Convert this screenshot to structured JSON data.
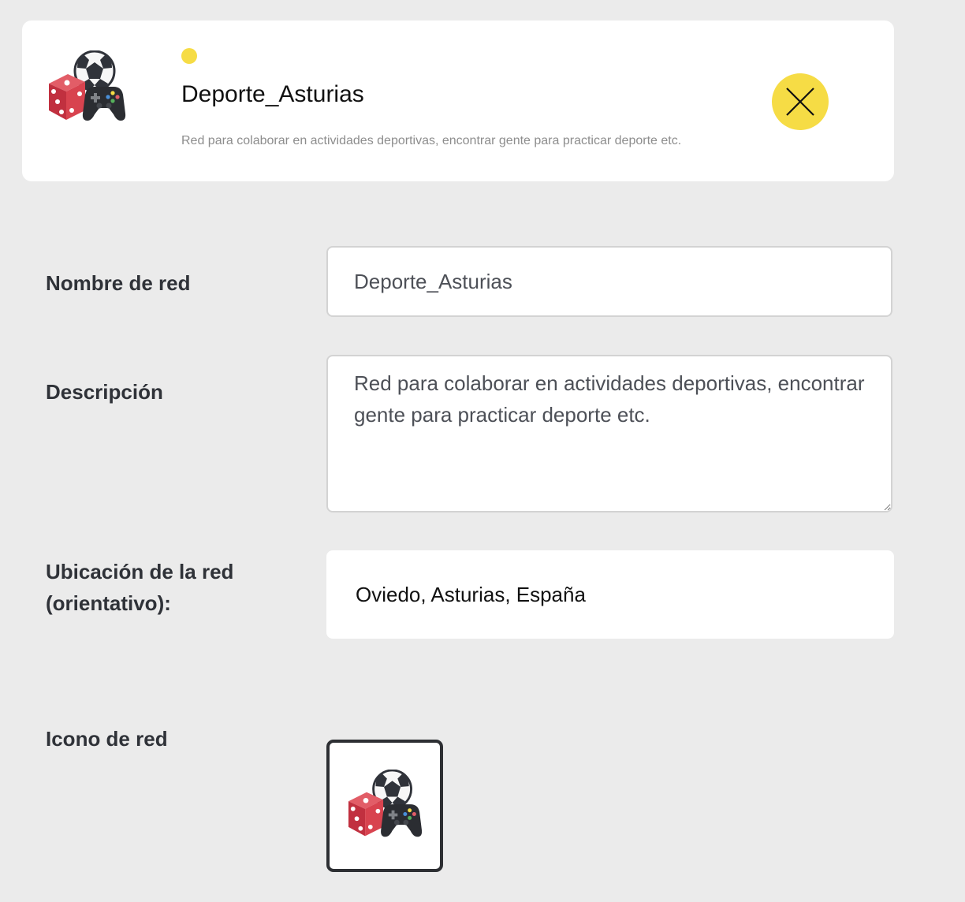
{
  "header": {
    "title": "Deporte_Asturias",
    "description": "Red para colaborar en actividades deportivas, encontrar gente para practicar deporte etc.",
    "status_color": "#f6dc45",
    "logo_icons": [
      "dice-icon",
      "soccer-ball-icon",
      "gamepad-icon"
    ],
    "close_icon": "close-icon"
  },
  "form": {
    "name_label": "Nombre de red",
    "name_value": "Deporte_Asturias",
    "description_label": "Descripción",
    "description_value": "Red para colaborar en actividades deportivas, encontrar gente para practicar deporte etc.",
    "location_label_line1": "Ubicación de la red",
    "location_label_line2": "(orientativo):",
    "location_value": "Oviedo, Asturias, España",
    "icon_label": "Icono de red"
  },
  "colors": {
    "accent": "#f6dc45",
    "background": "#ebebeb",
    "card": "#ffffff"
  }
}
